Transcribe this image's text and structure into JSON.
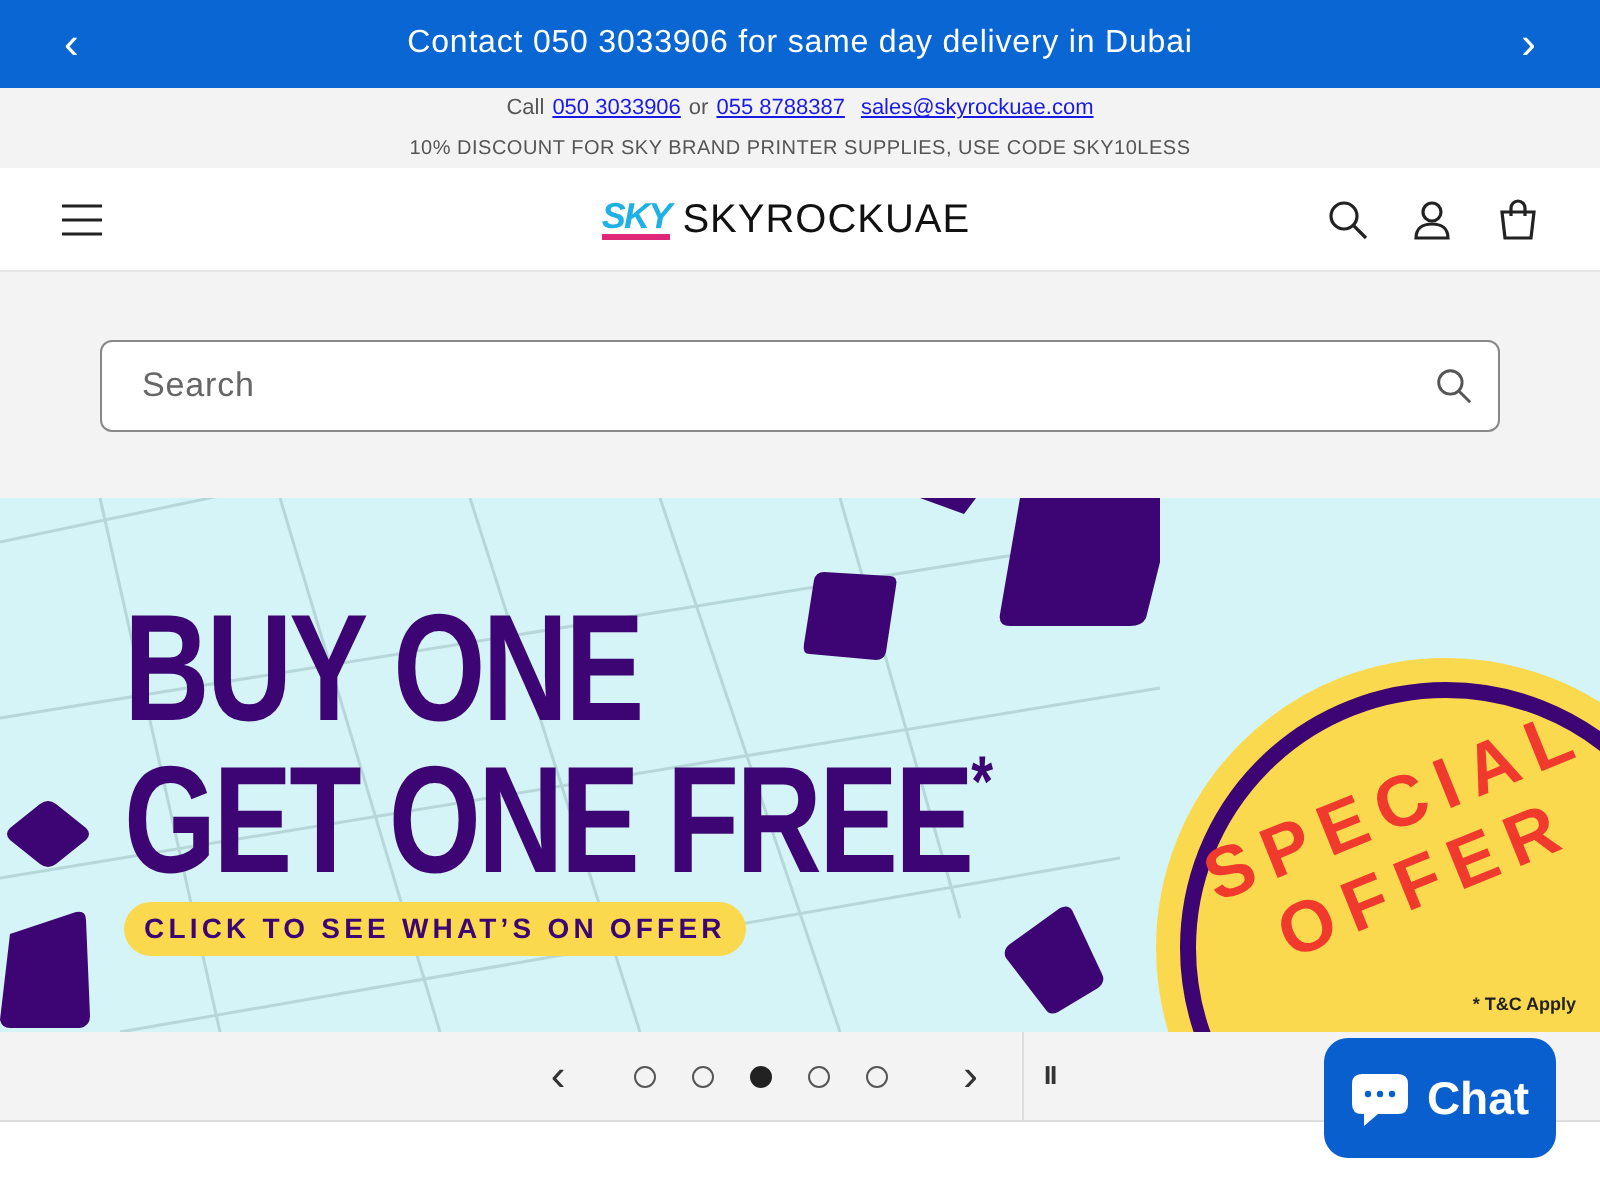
{
  "announcement": {
    "text": "Contact 050 3033906 for same day delivery in Dubai",
    "prev": "‹",
    "next": "›"
  },
  "contact_bar": {
    "call_label": "Call",
    "phone_1": "050 3033906",
    "or_label": "or",
    "phone_2": "055 8788387",
    "email": "sales@skyrockuae.com",
    "promo": "10% DISCOUNT FOR SKY BRAND PRINTER SUPPLIES, USE CODE SKY10LESS"
  },
  "header": {
    "logo_mark": "SKY",
    "store_name": "SKYROCKUAE"
  },
  "search": {
    "placeholder": "Search"
  },
  "banner": {
    "line_1": "BUY ONE",
    "line_2": "GET ONE FREE$^{*}$",
    "cta": "CLICK TO SEE WHAT’S ON OFFER",
    "badge_line_1": "SPECIAL",
    "badge_line_2": "OFFER",
    "terms": "* T&C Apply"
  },
  "slider": {
    "prev": "‹",
    "next": "›",
    "pause": "II",
    "slides": [
      {
        "selected": false
      },
      {
        "selected": false
      },
      {
        "selected": true
      },
      {
        "selected": false
      },
      {
        "selected": false
      }
    ]
  },
  "chat": {
    "label": "Chat"
  }
}
